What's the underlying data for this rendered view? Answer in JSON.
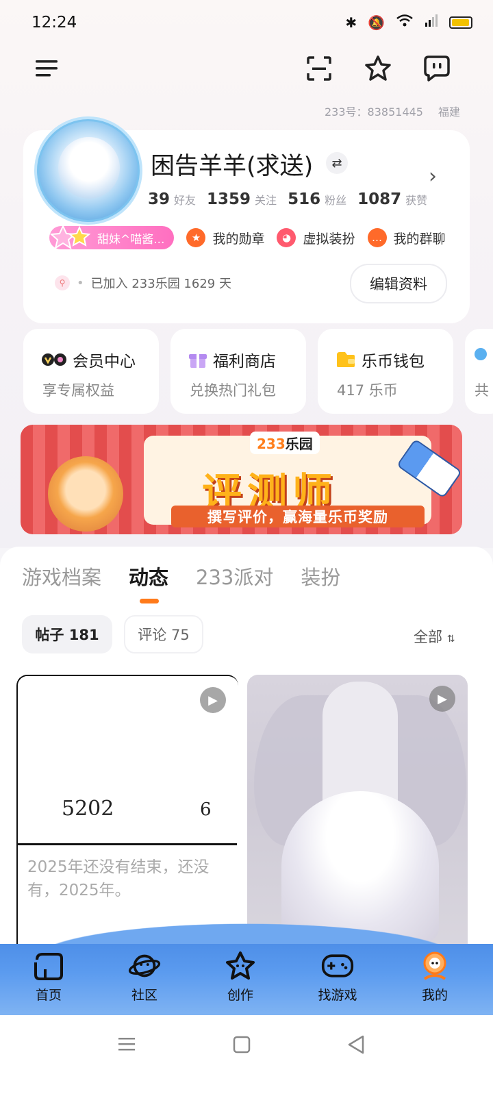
{
  "status_bar": {
    "time": "12:24"
  },
  "header": {
    "account_id": "233号：83851445",
    "region": "福建"
  },
  "profile": {
    "name": "困告羊羊(求送)",
    "stats": [
      {
        "value": "39",
        "label": "好友"
      },
      {
        "value": "1359",
        "label": "关注"
      },
      {
        "value": "516",
        "label": "粉丝"
      },
      {
        "value": "1087",
        "label": "获赞"
      }
    ],
    "vip_chip": "甜妹^喵酱...",
    "links": [
      {
        "label": "我的勋章",
        "color": "#ff6a2a"
      },
      {
        "label": "虚拟装扮",
        "color": "#ff5a6e"
      },
      {
        "label": "我的群聊",
        "color": "#ff6a2a"
      }
    ],
    "joined": "已加入 233乐园 1629 天",
    "edit_button": "编辑资料"
  },
  "quick_cards": [
    {
      "title": "会员中心",
      "sub": "享专属权益",
      "icon": "vip-icon"
    },
    {
      "title": "福利商店",
      "sub": "兑换热门礼包",
      "icon": "gift-icon"
    },
    {
      "title": "乐币钱包",
      "sub": "417 乐币",
      "icon": "wallet-icon"
    },
    {
      "title": "",
      "sub": "共",
      "icon": "more-icon"
    }
  ],
  "banner": {
    "logo_num": "233",
    "logo_text": "乐园",
    "title": "评测师",
    "subtitle": "撰写评价，赢海量乐币奖励"
  },
  "tabs": [
    {
      "label": "游戏档案",
      "active": false
    },
    {
      "label": "动态",
      "active": true
    },
    {
      "label": "233派对",
      "active": false
    },
    {
      "label": "装扮",
      "active": false
    }
  ],
  "filters": {
    "posts": "帖子 181",
    "comments": "评论 75",
    "sort": "全部"
  },
  "posts": [
    {
      "num_left": "5202",
      "num_right": "6",
      "text": "2025年还没有结束，还没有，2025年。"
    }
  ],
  "bottom_nav": [
    {
      "label": "首页",
      "icon": "home-icon"
    },
    {
      "label": "社区",
      "icon": "planet-icon"
    },
    {
      "label": "创作",
      "icon": "star-icon"
    },
    {
      "label": "找游戏",
      "icon": "gamepad-icon"
    },
    {
      "label": "我的",
      "icon": "profile-icon",
      "active": true
    }
  ]
}
